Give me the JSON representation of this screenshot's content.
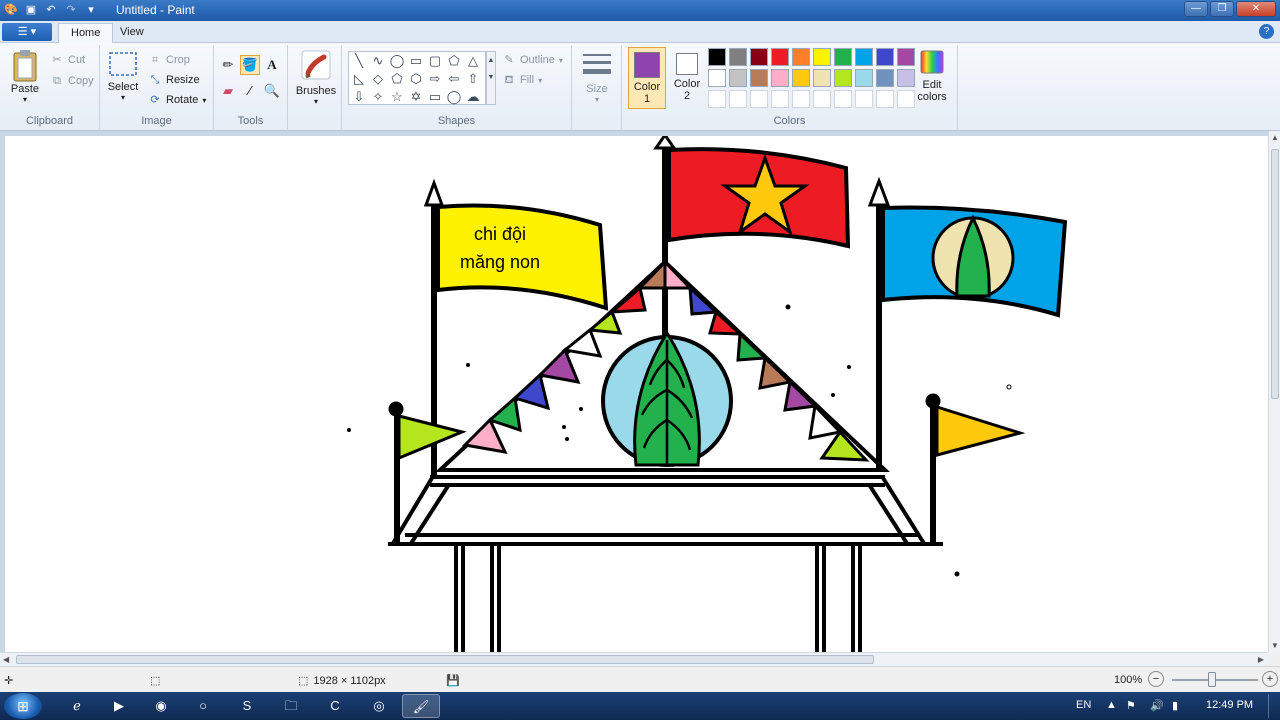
{
  "titlebar": {
    "title": "Untitled - Paint",
    "quick_access": [
      "paint-app-icon",
      "save-icon",
      "undo-icon",
      "redo-icon",
      "customize-icon"
    ],
    "controls": [
      "minimize",
      "maximize",
      "close"
    ]
  },
  "tabs": {
    "home": "Home",
    "view": "View"
  },
  "ribbon": {
    "clipboard": {
      "label": "Clipboard",
      "paste": "Paste",
      "cut": "Cut",
      "copy": "Copy"
    },
    "image": {
      "label": "Image",
      "select": "Select",
      "crop": "Crop",
      "resize": "Resize",
      "rotate": "Rotate"
    },
    "tools": {
      "label": "Tools"
    },
    "brushes": {
      "label": "Brushes"
    },
    "shapes": {
      "label": "Shapes",
      "outline": "Outline",
      "fill": "Fill"
    },
    "size": {
      "label": "Size"
    },
    "colors": {
      "label": "Colors",
      "color1": "Color\n1",
      "color1_value": "#8e44ad",
      "color2": "Color\n2",
      "color2_value": "#ffffff",
      "edit": "Edit colors",
      "palette_row1": [
        "#000000",
        "#7f7f7f",
        "#880015",
        "#ed1c24",
        "#ff7f27",
        "#fff200",
        "#22b14c",
        "#00a2e8",
        "#3f48cc",
        "#a349a4"
      ],
      "palette_row2": [
        "#ffffff",
        "#c3c3c3",
        "#b97a57",
        "#ffaec9",
        "#ffc90e",
        "#efe4b0",
        "#b5e61d",
        "#99d9ea",
        "#7092be",
        "#c8bfe7"
      ],
      "palette_row3": [
        "#ffffff",
        "#ffffff",
        "#ffffff",
        "#ffffff",
        "#ffffff",
        "#ffffff",
        "#ffffff",
        "#ffffff",
        "#ffffff",
        "#ffffff"
      ]
    }
  },
  "canvas": {
    "flag_text_line1": "chi đội",
    "flag_text_line2": "măng non"
  },
  "statusbar": {
    "image_size": "1928 × 1102px",
    "zoom": "100%"
  },
  "taskbar": {
    "apps": [
      "internet-explorer-icon",
      "media-player-icon",
      "chrome-icon",
      "unknown-app-icon",
      "skype-icon",
      "file-explorer-icon",
      "camtasia-icon",
      "unknown-app-icon-2",
      "paint-icon"
    ],
    "language": "EN",
    "clock": "12:49 PM"
  }
}
